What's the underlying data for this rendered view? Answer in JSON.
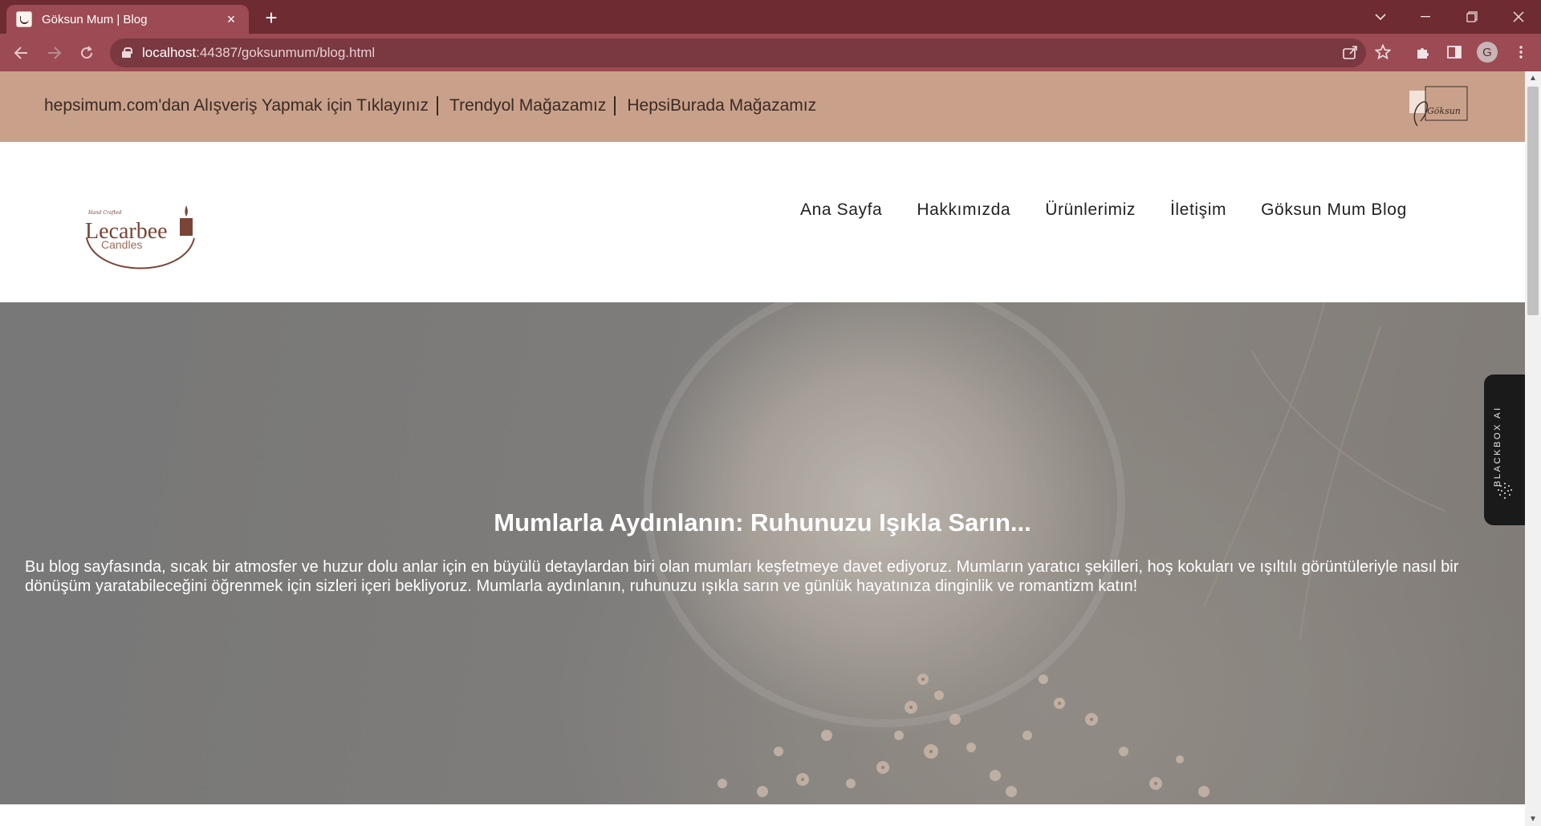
{
  "browser": {
    "tab_title": "Göksun Mum | Blog",
    "url_host": "localhost",
    "url_path": ":44387/goksunmum/blog.html",
    "profile_initial": "G"
  },
  "topbar": {
    "links": [
      "hepsimum.com'dan Alışveriş Yapmak için Tıklayınız",
      "Trendyol Mağazamız",
      "HepsiBurada Mağazamız"
    ],
    "mini_logo_text": "Göksun"
  },
  "brand": {
    "script": "Hand Crafted",
    "name": "Lecarbee",
    "sub": "Candles"
  },
  "nav": [
    "Ana Sayfa",
    "Hakkımızda",
    "Ürünlerimiz",
    "İletişim",
    "Göksun Mum Blog"
  ],
  "hero": {
    "title": "Mumlarla Aydınlanın: Ruhunuzu Işıkla Sarın...",
    "text": "Bu blog sayfasında, sıcak bir atmosfer ve huzur dolu anlar için en büyülü detaylardan biri olan mumları keşfetmeye davet ediyoruz. Mumların yaratıcı şekilleri, hoş kokuları ve ışıltılı görüntüleriyle nasıl bir dönüşüm yaratabileceğini öğrenmek için sizleri içeri bekliyoruz. Mumlarla aydınlanın, ruhunuzu ışıkla sarın ve günlük hayatınıza dinginlik ve romantizm katın!"
  },
  "side_widget": {
    "label": "BLACKBOX AI"
  },
  "colors": {
    "tabstrip": "#6e2b31",
    "toolbar": "#9c4a53",
    "topbar": "#c9a18a",
    "brand": "#7a4536"
  }
}
